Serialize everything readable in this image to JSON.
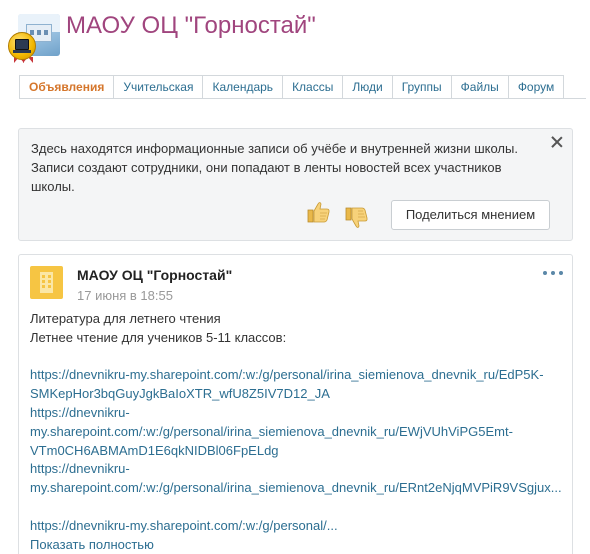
{
  "header": {
    "title": "МАОУ ОЦ \"Горностай\""
  },
  "tabs": [
    {
      "label": "Объявления",
      "active": true
    },
    {
      "label": "Учительская",
      "active": false
    },
    {
      "label": "Календарь",
      "active": false
    },
    {
      "label": "Классы",
      "active": false
    },
    {
      "label": "Люди",
      "active": false
    },
    {
      "label": "Группы",
      "active": false
    },
    {
      "label": "Файлы",
      "active": false
    },
    {
      "label": "Форум",
      "active": false
    }
  ],
  "info": {
    "text": "Здесь находятся информационные записи об учёбе и внутренней жизни школы. Записи создают сотрудники, они попадают в ленты новостей всех участников школы.",
    "share_label": "Поделиться мнением",
    "icons": [
      "thumbs-up-icon",
      "thumbs-down-icon",
      "close-icon"
    ]
  },
  "post": {
    "author": "МАОУ ОЦ \"Горностай\"",
    "date": "17 июня в 18:55",
    "lines": [
      "Литература для летнего чтения",
      "Летнее чтение для учеников 5-11 классов:"
    ],
    "links": [
      [
        "https://dnevnikru-my.sharepoint.com/:w:/g/personal/irina_siemienova_dnevnik_ru/EdP5K-",
        "SMKepHor3bqGuyJgkBaIoXTR_wfU8Z5IV7D12_JA"
      ],
      [
        "https://dnevnikru-",
        "my.sharepoint.com/:w:/g/personal/irina_siemienova_dnevnik_ru/EWjVUhViPG5Emt-",
        "VTm0CH6ABMAmD1E6qkNIDBl06FpELdg"
      ],
      [
        "https://dnevnikru-",
        "my.sharepoint.com/:w:/g/personal/irina_siemienova_dnevnik_ru/ERnt2eNjqMVPiR9VSgjux..."
      ],
      [
        "https://dnevnikru-my.sharepoint.com/:w:/g/personal/..."
      ]
    ],
    "show_more": "Показать полностью",
    "accent_color": "#f6c543"
  },
  "colors": {
    "title": "#a0457e",
    "link": "#2c6e91",
    "active_tab": "#d5762b"
  }
}
